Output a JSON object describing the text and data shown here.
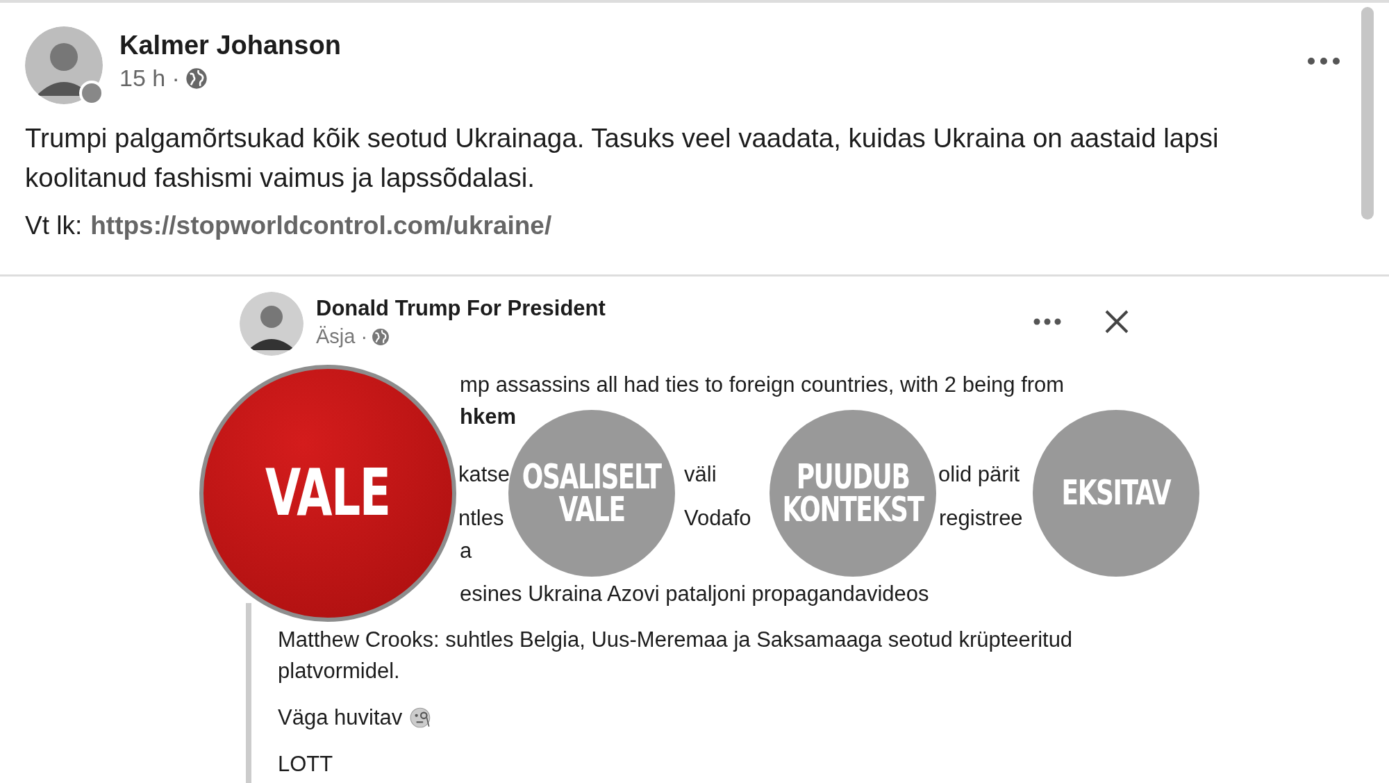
{
  "post": {
    "author": "Kalmer Johanson",
    "time": "15 h ·",
    "text": "Trumpi palgamõrtsukad kõik seotud Ukrainaga. Tasuks veel vaadata, kuidas Ukraina on aastaid lapsi koolitanud fashismi vaimus ja lapssõdalasi.",
    "link_prefix": "Vt lk:",
    "link": "https://stopworldcontrol.com/ukraine/"
  },
  "shared_post": {
    "author": "Donald Trump For President",
    "time": "Äsja ·",
    "partial_lines": [
      {
        "fragments": [
          "mp assassins all had ties to foreign countries, with 2 being from"
        ],
        "bold": false
      },
      {
        "fragments": [
          "hkem"
        ],
        "bold": true
      },
      {
        "fragments": [
          "katse",
          "väli",
          "olid pärit"
        ],
        "bold": false
      },
      {
        "fragments": [
          "ntles",
          "Vodafo",
          "registree"
        ],
        "bold": false
      },
      {
        "fragments": [
          "a"
        ],
        "bold": false
      },
      {
        "fragments": [
          "esines Ukraina Azovi pataljoni propagandavideos"
        ],
        "bold": false
      }
    ],
    "lines": [
      "Matthew Crooks: suhtles Belgia, Uus-Meremaa ja Saksamaaga seotud krüpteeritud platvormidel.",
      "Väga huvitav",
      "LOTT"
    ]
  },
  "ratings": [
    {
      "label": [
        "VALE"
      ],
      "selected": true
    },
    {
      "label": [
        "OSALISELT",
        "VALE"
      ],
      "selected": false
    },
    {
      "label": [
        "PUUDUB",
        "KONTEKST"
      ],
      "selected": false
    },
    {
      "label": [
        "EKSITAV"
      ],
      "selected": false
    }
  ]
}
